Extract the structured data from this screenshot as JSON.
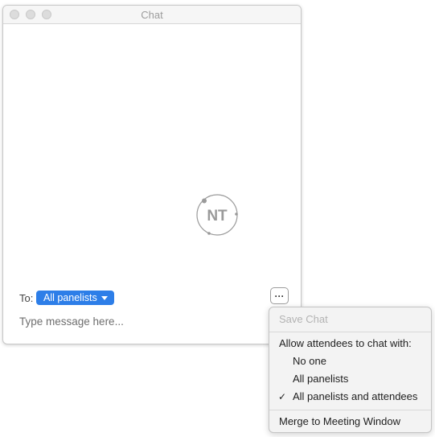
{
  "window": {
    "title": "Chat"
  },
  "watermark": {
    "initials": "NT"
  },
  "composer": {
    "to_label": "To:",
    "recipient": "All panelists",
    "placeholder": "Type message here...",
    "more_label": "···"
  },
  "menu": {
    "save_chat": "Save Chat",
    "allow_header": "Allow attendees to chat with:",
    "options": [
      {
        "label": "No one",
        "checked": false
      },
      {
        "label": "All panelists",
        "checked": false
      },
      {
        "label": "All panelists and attendees",
        "checked": true
      }
    ],
    "check_mark": "✓",
    "merge": "Merge to Meeting Window"
  },
  "colors": {
    "accent": "#2d7ee8",
    "window_border": "#c8c8c8",
    "menu_bg": "#f3f3f3"
  }
}
